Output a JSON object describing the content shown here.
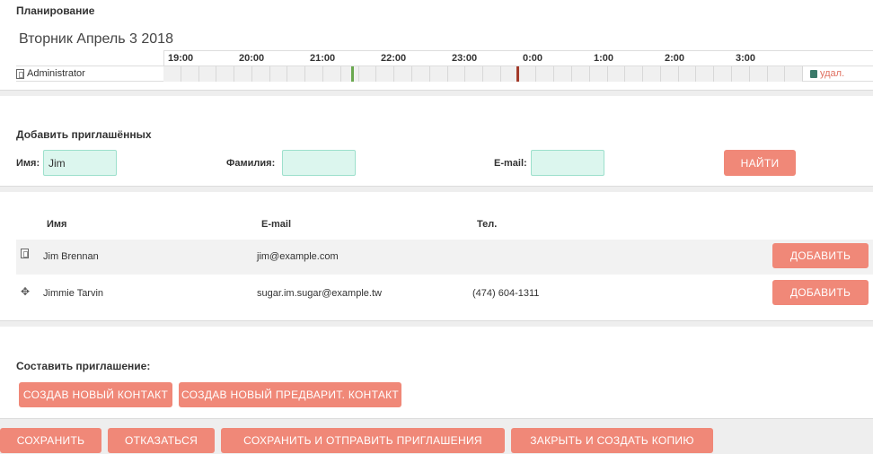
{
  "scheduling": {
    "title": "Планирование",
    "date": "Вторник Апрель 3 2018",
    "hours": [
      "19:00",
      "20:00",
      "21:00",
      "22:00",
      "23:00",
      "0:00",
      "1:00",
      "2:00",
      "3:00"
    ],
    "user_name": "Administrator",
    "remove_label": "удал."
  },
  "add_invitees": {
    "title": "Добавить приглашённых",
    "first_name_label": "Имя:",
    "first_name_value": "Jim",
    "last_name_label": "Фамилия:",
    "last_name_value": "",
    "email_label": "E-mail:",
    "email_value": "",
    "search_button": "НАЙТИ"
  },
  "results": {
    "columns": [
      "Имя",
      "E-mail",
      "Тел."
    ],
    "rows": [
      {
        "name": "Jim Brennan",
        "email": "jim@example.com",
        "phone": "",
        "icon": "contact-card-icon",
        "button": "ДОБАВИТЬ"
      },
      {
        "name": "Jimmie Tarvin",
        "email": "sugar.im.sugar@example.tw",
        "phone": "(474) 604-1311",
        "icon": "lead-move-icon",
        "button": "ДОБАВИТЬ"
      }
    ]
  },
  "compose": {
    "title": "Составить приглашение:",
    "create_contact": "СОЗДАВ НОВЫЙ КОНТАКТ",
    "create_lead": "СОЗДАВ НОВЫЙ ПРЕДВАРИТ. КОНТАКТ"
  },
  "footer": {
    "save": "СОХРАНИТЬ",
    "cancel": "ОТКАЗАТЬСЯ",
    "save_send": "СОХРАНИТЬ И ОТПРАВИТЬ ПРИГЛАШЕНИЯ",
    "close_copy": "ЗАКРЫТЬ И СОЗДАТЬ КОПИЮ"
  },
  "colors": {
    "button": "#f08878",
    "input_bg": "#dcf6ee",
    "meeting_start": "#6aa84f",
    "meeting_end": "#a33a2a"
  }
}
